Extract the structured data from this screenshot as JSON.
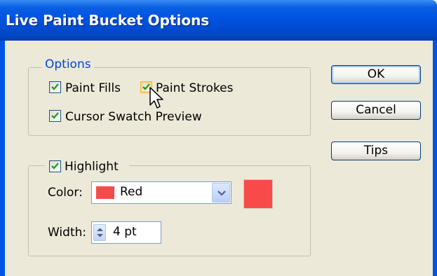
{
  "window": {
    "title": "Live Paint Bucket Options"
  },
  "options": {
    "legend": "Options",
    "paint_fills": {
      "label": "Paint Fills",
      "checked": true
    },
    "paint_strokes": {
      "label": "Paint Strokes",
      "checked": true
    },
    "cursor_swatch_preview": {
      "label": "Cursor Swatch Preview",
      "checked": true
    }
  },
  "highlight": {
    "label": "Highlight",
    "checked": true,
    "color_label": "Color:",
    "color_value": "Red",
    "color_hex": "#f94a4a",
    "width_label": "Width:",
    "width_value": "4 pt"
  },
  "buttons": {
    "ok": "OK",
    "cancel": "Cancel",
    "tips": "Tips"
  },
  "colors": {
    "titlebar": "#0054e3",
    "dialog_bg": "#ece9d8",
    "legend_text": "#0046d5",
    "check": "#21a121"
  }
}
